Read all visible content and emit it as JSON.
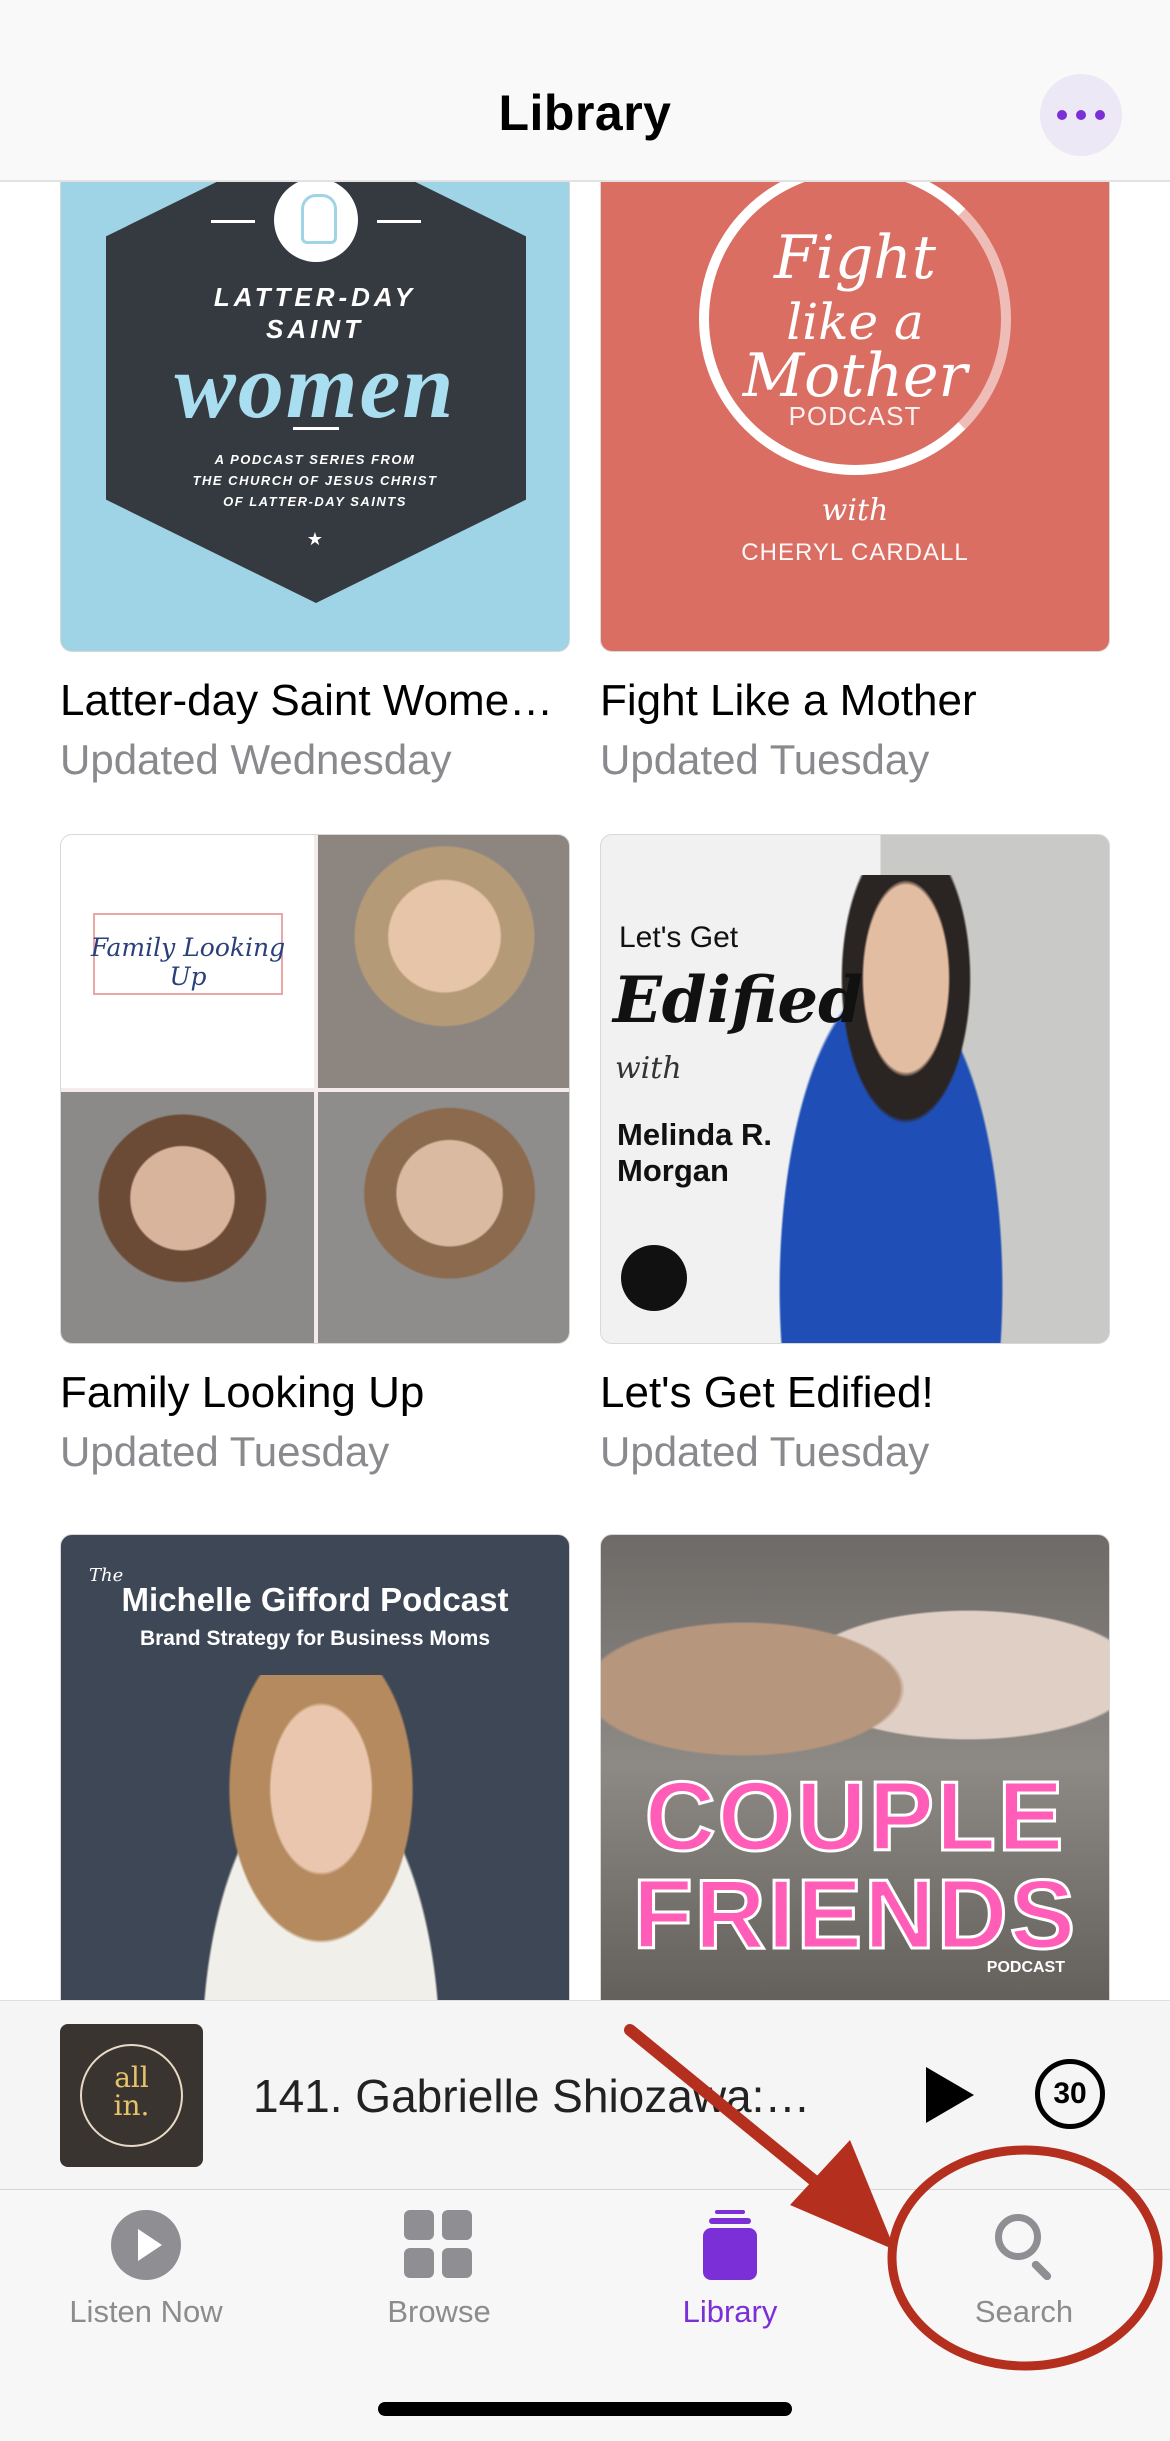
{
  "header": {
    "title": "Library",
    "more_icon": "ellipsis-icon"
  },
  "shows": [
    {
      "name": "Latter-day Saint Wome…",
      "updated": "Updated Wednesday",
      "art": {
        "line1": "LATTER-DAY",
        "line2": "SAINT",
        "line3": "women",
        "line4": "A PODCAST SERIES FROM",
        "line5": "THE CHURCH OF JESUS CHRIST",
        "line6": "OF LATTER-DAY SAINTS",
        "star": "★"
      }
    },
    {
      "name": "Fight Like a Mother",
      "updated": "Updated Tuesday",
      "art": {
        "line1": "Fight",
        "line2": "like a",
        "line3": "Mother",
        "line4": "PODCAST",
        "line5": "with",
        "line6": "CHERYL CARDALL"
      }
    },
    {
      "name": "Family Looking Up",
      "updated": "Updated Tuesday",
      "art": {
        "line1": "Family Looking Up"
      }
    },
    {
      "name": "Let's Get Edified!",
      "updated": "Updated Tuesday",
      "art": {
        "line1": "Let's Get",
        "line2": "Edified",
        "line3": "with",
        "line4": "Melinda R.",
        "line5": "Morgan"
      }
    },
    {
      "name": "",
      "updated": "",
      "art": {
        "line1": "The",
        "line2": "Michelle Gifford Podcast",
        "line3": "Brand Strategy for Business Moms"
      }
    },
    {
      "name": "",
      "updated": "",
      "art": {
        "line1": "COUPLE",
        "line2": "FRIENDS",
        "line3": "PODCAST"
      }
    }
  ],
  "player": {
    "track": "141. Gabrielle Shiozawa:…",
    "thumb_line1": "all",
    "thumb_line2": "in.",
    "skip_label": "30"
  },
  "tabs": [
    {
      "label": "Listen Now",
      "icon": "play-circle-icon"
    },
    {
      "label": "Browse",
      "icon": "grid-icon"
    },
    {
      "label": "Library",
      "icon": "library-icon",
      "active": true
    },
    {
      "label": "Search",
      "icon": "search-icon"
    }
  ],
  "colors": {
    "accent": "#7b2fd6",
    "annotation": "#b52f1f"
  }
}
